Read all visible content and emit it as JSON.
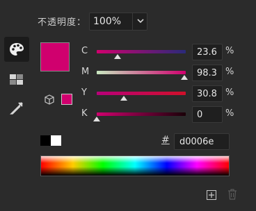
{
  "opacity": {
    "label": "不透明度：",
    "value": "100%"
  },
  "sliders": [
    {
      "letter": "C",
      "value": "23.6",
      "level": 0.236,
      "gradient": [
        "#d0006e",
        "#2a2a7a"
      ]
    },
    {
      "letter": "M",
      "value": "98.3",
      "level": 0.983,
      "gradient": [
        "#c8e8c0",
        "#d0006e"
      ]
    },
    {
      "letter": "Y",
      "value": "30.8",
      "level": 0.308,
      "gradient": [
        "#b8007a",
        "#d0102a"
      ]
    },
    {
      "letter": "K",
      "value": "0",
      "level": 0.0,
      "gradient": [
        "#d0006e",
        "#1a0008"
      ]
    }
  ],
  "percent_sign": "%",
  "hex": {
    "label": "#",
    "value": "d0006e"
  },
  "colors": {
    "current": "#d0006e",
    "panel_bg": "#2b2b2b"
  },
  "icons": {
    "wheel": "color-wheel-icon",
    "swatches": "swatches-icon",
    "eyedropper": "eyedropper-icon",
    "cube": "gamut-cube-icon",
    "add": "add-icon",
    "trash": "trash-icon"
  }
}
